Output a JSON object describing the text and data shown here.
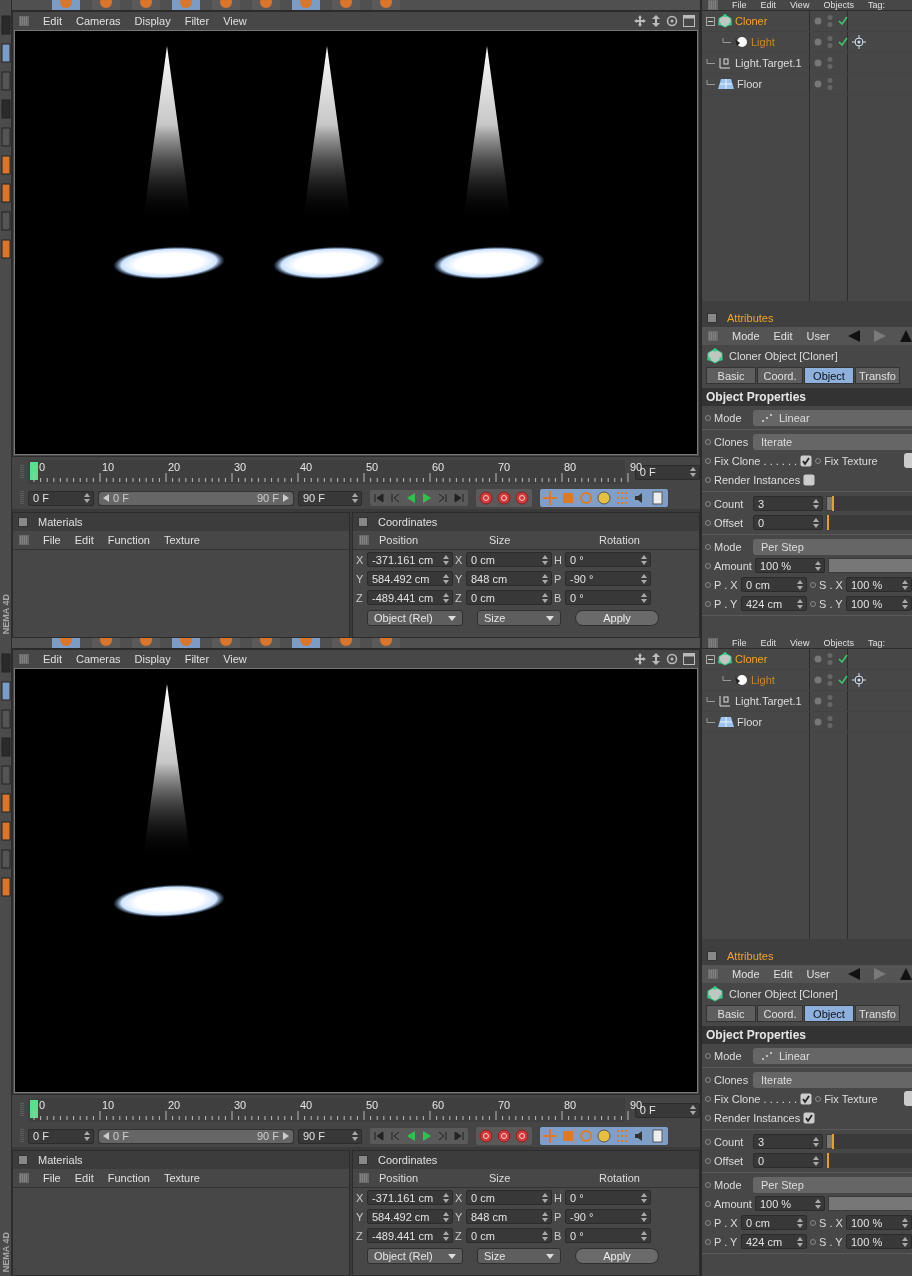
{
  "screens": [
    {
      "brand_text": "NEMA 4D",
      "viewport": {
        "menu": [
          "Edit",
          "Cameras",
          "Display",
          "Filter",
          "View"
        ],
        "spots": [
          {
            "kind": "spotlight"
          },
          {
            "kind": "spotlight"
          },
          {
            "kind": "spotlight"
          }
        ]
      },
      "timeline": {
        "ticks": [
          "0",
          "10",
          "20",
          "30",
          "40",
          "50",
          "60",
          "70",
          "80",
          "90"
        ],
        "current_frame": "0 F"
      },
      "transport": {
        "start": "0 F",
        "range_start": "0 F",
        "range_end": "90 F",
        "end": "90 F",
        "level": 1
      },
      "materials": {
        "title": "Materials",
        "menu": [
          "File",
          "Edit",
          "Function",
          "Texture"
        ]
      },
      "coordinates": {
        "title": "Coordinates",
        "headers": [
          "Position",
          "Size",
          "Rotation"
        ],
        "rows": [
          {
            "axis": "X",
            "position": "-371.161 cm",
            "size_axis": "X",
            "size": "0 cm",
            "rotation_axis": "H",
            "rotation": "0 °"
          },
          {
            "axis": "Y",
            "position": "584.492 cm",
            "size_axis": "Y",
            "size": "848 cm",
            "rotation_axis": "P",
            "rotation": "-90 °"
          },
          {
            "axis": "Z",
            "position": "-489.441 cm",
            "size_axis": "Z",
            "size": "0 cm",
            "rotation_axis": "B",
            "rotation": "0 °"
          }
        ],
        "buttons": [
          {
            "label": "Object (Rel)",
            "kind": "dropdown"
          },
          {
            "label": "Size",
            "kind": "dropdown"
          },
          {
            "label": "Apply",
            "kind": "button"
          }
        ]
      },
      "objects": {
        "menu": [
          "File",
          "Edit",
          "View",
          "Objects",
          "Tag:"
        ],
        "items": [
          {
            "name": "Cloner",
            "kind": "cloner",
            "selected": true,
            "enabled": true,
            "expanded": true,
            "target_tag": false,
            "children": [
              {
                "name": "Light",
                "kind": "light",
                "selected": true,
                "enabled": true,
                "target_tag": true
              }
            ]
          },
          {
            "name": "Light.Target.1",
            "kind": "null",
            "selected": false,
            "enabled": false,
            "target_tag": false
          },
          {
            "name": "Floor",
            "kind": "floor",
            "selected": false,
            "enabled": false,
            "target_tag": false
          }
        ]
      },
      "attributes": {
        "title": "Attributes",
        "menu": [
          "Mode",
          "Edit",
          "User"
        ],
        "object_title": "Cloner Object [Cloner]",
        "tabs": [
          {
            "label": "Basic",
            "selected": false
          },
          {
            "label": "Coord.",
            "selected": false
          },
          {
            "label": "Object",
            "selected": true
          },
          {
            "label": "Transfo",
            "selected": false
          }
        ],
        "section": "Object Properties",
        "groups": [
          [
            {
              "kind": "dropdown",
              "label": "Mode",
              "value": "Linear"
            }
          ],
          [
            {
              "kind": "dropdown",
              "label": "Clones",
              "value": "Iterate"
            },
            {
              "kind": "checkpair",
              "label": "Fix Clone . . . . . .",
              "checked": true,
              "label_2": "Fix Texture"
            },
            {
              "kind": "checkbox",
              "label": "Render Instances",
              "checked": false
            }
          ],
          [
            {
              "kind": "slider",
              "label": "Count",
              "value": "3",
              "level": 0.06
            },
            {
              "kind": "slider",
              "label": "Offset",
              "value": "0",
              "level": 0
            }
          ],
          [
            {
              "kind": "dropdown",
              "label": "Mode",
              "value": "Per Step"
            },
            {
              "kind": "slider",
              "label": "Amount",
              "value": "100 %",
              "level": 1
            },
            {
              "kind": "pair",
              "label": "P . X",
              "value": "0 cm",
              "label_2": "S . X",
              "value_2": "100 %"
            },
            {
              "kind": "pair",
              "label": "P . Y",
              "value": "424 cm",
              "label_2": "S . Y",
              "value_2": "100 %"
            }
          ]
        ]
      }
    },
    {
      "brand_text": "NEMA 4D",
      "viewport": {
        "menu": [
          "Edit",
          "Cameras",
          "Display",
          "Filter",
          "View"
        ],
        "spots": [
          {
            "kind": "spotlight"
          }
        ]
      },
      "timeline": {
        "ticks": [
          "0",
          "10",
          "20",
          "30",
          "40",
          "50",
          "60",
          "70",
          "80",
          "90"
        ],
        "current_frame": "0 F"
      },
      "transport": {
        "start": "0 F",
        "range_start": "0 F",
        "range_end": "90 F",
        "end": "90 F",
        "level": 1
      },
      "materials": {
        "title": "Materials",
        "menu": [
          "File",
          "Edit",
          "Function",
          "Texture"
        ]
      },
      "coordinates": {
        "title": "Coordinates",
        "headers": [
          "Position",
          "Size",
          "Rotation"
        ],
        "rows": [
          {
            "axis": "X",
            "position": "-371.161 cm",
            "size_axis": "X",
            "size": "0 cm",
            "rotation_axis": "H",
            "rotation": "0 °"
          },
          {
            "axis": "Y",
            "position": "584.492 cm",
            "size_axis": "Y",
            "size": "848 cm",
            "rotation_axis": "P",
            "rotation": "-90 °"
          },
          {
            "axis": "Z",
            "position": "-489.441 cm",
            "size_axis": "Z",
            "size": "0 cm",
            "rotation_axis": "B",
            "rotation": "0 °"
          }
        ],
        "buttons": [
          {
            "label": "Object (Rel)",
            "kind": "dropdown"
          },
          {
            "label": "Size",
            "kind": "dropdown"
          },
          {
            "label": "Apply",
            "kind": "button"
          }
        ]
      },
      "objects": {
        "menu": [
          "File",
          "Edit",
          "View",
          "Objects",
          "Tag:"
        ],
        "items": [
          {
            "name": "Cloner",
            "kind": "cloner",
            "selected": true,
            "enabled": true,
            "expanded": true,
            "target_tag": false,
            "children": [
              {
                "name": "Light",
                "kind": "light",
                "selected": true,
                "enabled": true,
                "target_tag": true
              }
            ]
          },
          {
            "name": "Light.Target.1",
            "kind": "null",
            "selected": false,
            "enabled": false,
            "target_tag": false
          },
          {
            "name": "Floor",
            "kind": "floor",
            "selected": false,
            "enabled": false,
            "target_tag": false
          }
        ]
      },
      "attributes": {
        "title": "Attributes",
        "menu": [
          "Mode",
          "Edit",
          "User"
        ],
        "object_title": "Cloner Object [Cloner]",
        "tabs": [
          {
            "label": "Basic",
            "selected": false
          },
          {
            "label": "Coord.",
            "selected": false
          },
          {
            "label": "Object",
            "selected": true
          },
          {
            "label": "Transfo",
            "selected": false
          }
        ],
        "section": "Object Properties",
        "groups": [
          [
            {
              "kind": "dropdown",
              "label": "Mode",
              "value": "Linear"
            }
          ],
          [
            {
              "kind": "dropdown",
              "label": "Clones",
              "value": "Iterate"
            },
            {
              "kind": "checkpair",
              "label": "Fix Clone . . . . . .",
              "checked": true,
              "label_2": "Fix Texture"
            },
            {
              "kind": "checkbox",
              "label": "Render Instances",
              "checked": true
            }
          ],
          [
            {
              "kind": "slider",
              "label": "Count",
              "value": "3",
              "level": 0.06
            },
            {
              "kind": "slider",
              "label": "Offset",
              "value": "0",
              "level": 0
            }
          ],
          [
            {
              "kind": "dropdown",
              "label": "Mode",
              "value": "Per Step"
            },
            {
              "kind": "slider",
              "label": "Amount",
              "value": "100 %",
              "level": 1
            },
            {
              "kind": "pair",
              "label": "P . X",
              "value": "0 cm",
              "label_2": "S . X",
              "value_2": "100 %"
            },
            {
              "kind": "pair",
              "label": "P . Y",
              "value": "424 cm",
              "label_2": "S . Y",
              "value_2": "100 %"
            }
          ]
        ]
      }
    }
  ]
}
